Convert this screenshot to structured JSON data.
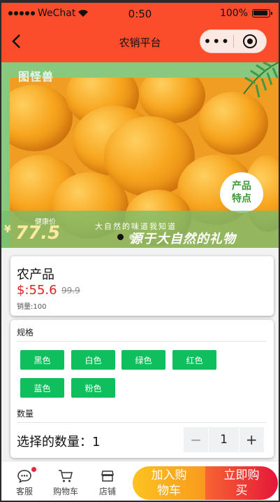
{
  "status_bar": {
    "carrier": "WeChat",
    "time": "0:50",
    "battery": "100%"
  },
  "nav": {
    "title": "农销平台",
    "more_icon": "•••"
  },
  "banner": {
    "logo_text": "图怪兽",
    "price_label": "健康价",
    "currency": "¥",
    "price": "77.5",
    "slogan_small": "大自然的味道我知道",
    "slogan_big": "源于大自然的礼物",
    "badge_line1": "产品",
    "badge_line2": "特点"
  },
  "product": {
    "name": "农产品",
    "price": "$:55.6",
    "original_price": "99.9",
    "sales": "销量:100"
  },
  "spec": {
    "title": "规格",
    "options": [
      "黑色",
      "白色",
      "绿色",
      "红色",
      "蓝色",
      "粉色"
    ],
    "quantity_title": "数量",
    "quantity_label": "选择的数量：",
    "quantity_value": "1",
    "minus": "−",
    "stepper_value": "1",
    "plus": "+"
  },
  "bottom_bar": {
    "service": "客服",
    "cart": "购物车",
    "store": "店铺",
    "add_to_cart": "加入购物车",
    "buy_now": "立即购买"
  },
  "colors": {
    "nav_bg": "#fb4d2b",
    "chip_green": "#0fbf5e",
    "price_red": "#e02020"
  }
}
